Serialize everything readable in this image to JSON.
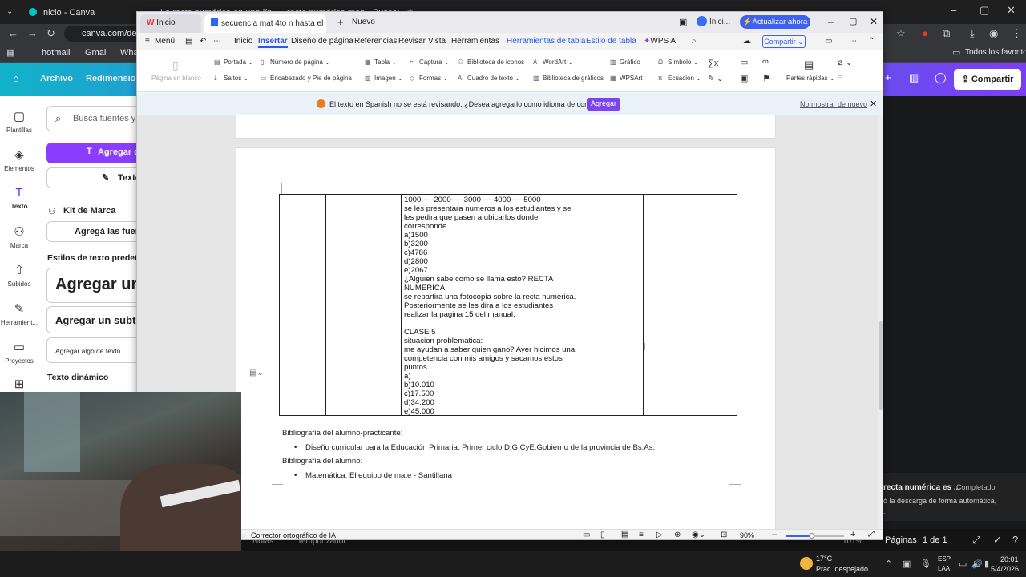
{
  "chrome": {
    "tabs": [
      "Inicio - Canva",
      "La recta numérica en una línea",
      "recta numérica mep - Buscar con"
    ],
    "address": "canva.com/desi",
    "bookmarks": [
      "hotmail",
      "Gmail",
      "Wha"
    ],
    "all_bookmarks": "Todos los favoritos"
  },
  "canva": {
    "menu_archivo": "Archivo",
    "menu_redim": "Redimensiona",
    "share": "Compartir",
    "rail": [
      "Plantillas",
      "Elementos",
      "Texto",
      "Marca",
      "Subidos",
      "Herramient...",
      "Proyectos"
    ],
    "search_placeholder": "Buscá fuentes y c",
    "add_text_btn": "Agregar c",
    "text_btn2": "Texto",
    "kit": "Kit de Marca",
    "add_fonts": "Agregá las fuente",
    "styles_title": "Estilos de texto predeter",
    "heading": "Agregar un",
    "subheading": "Agregar un subtít",
    "body": "Agregar algo de texto",
    "dynamic": "Texto dinámico",
    "bottom_notas": "Notas",
    "bottom_temp": "Temporizador",
    "pages_label": "Páginas",
    "pages_val": "1 de 1",
    "zoom_pct": "101%"
  },
  "wps": {
    "tabs": [
      "Inicio",
      "secuencia mat 4to n hasta el",
      "Nuevo"
    ],
    "account": "Inici...",
    "upgrade": "Actualizar ahora",
    "menu": [
      "Menú",
      "Inicio",
      "Insertar",
      "Diseño de página",
      "Referencias",
      "Revisar",
      "Vista",
      "Herramientas",
      "Herramientas de tabla",
      "Estilo de tabla",
      "WPS AI"
    ],
    "share": "Compartir",
    "ribbon": {
      "blank_page": "Página en blanco",
      "portada": "Portada",
      "saltos": "Saltos",
      "num_pagina": "Número de página",
      "encabezado": "Encabezado y Pie de página",
      "tabla": "Tabla",
      "imagen": "Imagen",
      "captura": "Captura",
      "formas": "Formas",
      "biblio_iconos": "Biblioteca de iconos",
      "cuadro_texto": "Cuadro de texto",
      "wordart": "WordArt",
      "biblio_graficos": "Biblioteca de gráficos",
      "grafico": "Gráfico",
      "wpsart": "WPSArt",
      "simbolo": "Símbolo",
      "ecuacion": "Ecuación",
      "partes": "Partes rápidas"
    },
    "notice": {
      "text": "El texto en Spanish no se está revisando. ¿Desea agregarlo como idioma de corrección?",
      "add_btn": "Agregar",
      "dismiss": "No mostrar de nuevo"
    },
    "cell_lines": [
      "1000-----2000-----3000-----4000-----5000",
      "se les presentara numeros a los estudiantes y se",
      "les pedira que pasen a ubicarlos donde",
      "corresponde",
      "a)1500",
      "b)3200",
      "c)4786",
      "d)2800",
      "e)2067",
      "¿Alguien sabe como se llama esto? RECTA",
      "NUMERICA",
      "se repartira una fotocopia sobre la recta numerica.",
      "Posteriormente se les dira a los estudiantes",
      "realizar la pagina 15 del manual.",
      "",
      "CLASE 5",
      "situacion problematica:",
      "me ayudan a saber quien gano? Ayer hicimos una",
      "competencia con mis amigos y sacamos estos",
      "puntos",
      "a)",
      "b)10.010",
      "c)17.500",
      "d)34.200",
      "e)45.000"
    ],
    "biblio_practicante": "Bibliografía del alumno-practicante:",
    "biblio_practicante_item": "Diseño curricular para la Educación Primaria, Primer ciclo.D.G.CyE.Gobierno de la provincia de Bs.As.",
    "biblio_alumno": "Bibliografía del alumno:",
    "biblio_alumno_item": "Matemática: El equipo de mate - Santillana",
    "status_spell": "Corrector ortográfico de IA",
    "zoom": "90%"
  },
  "toast": {
    "title": "recta numérica es ...",
    "state": "Completado",
    "body": "ó la descarga de forma automática,"
  },
  "taskbar": {
    "temp": "17°C",
    "weather": "Prac. despejado",
    "lang1": "ESP",
    "lang2": "LAA",
    "time": "20:01",
    "date": "5/4/2026"
  }
}
